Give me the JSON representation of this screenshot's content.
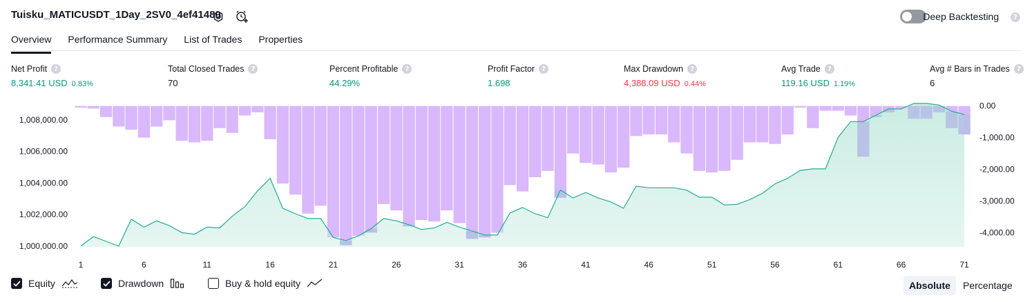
{
  "header": {
    "title": "Tuisku_MATICUSDT_1Day_2SV0_4ef41480",
    "deep_backtesting_label": "Deep Backtesting",
    "help_glyph": "?"
  },
  "tabs": [
    {
      "label": "Overview",
      "active": true
    },
    {
      "label": "Performance Summary",
      "active": false
    },
    {
      "label": "List of Trades",
      "active": false
    },
    {
      "label": "Properties",
      "active": false
    }
  ],
  "metrics": [
    {
      "label": "Net Profit",
      "value": "8,341.41 USD",
      "pct": "0.83%",
      "color": "green"
    },
    {
      "label": "Total Closed Trades",
      "value": "70",
      "pct": "",
      "color": "dark"
    },
    {
      "label": "Percent Profitable",
      "value": "44.29%",
      "pct": "",
      "color": "green"
    },
    {
      "label": "Profit Factor",
      "value": "1.698",
      "pct": "",
      "color": "green"
    },
    {
      "label": "Max Drawdown",
      "value": "4,388.09 USD",
      "pct": "0.44%",
      "color": "red"
    },
    {
      "label": "Avg Trade",
      "value": "119.16 USD",
      "pct": "1.19%",
      "color": "green"
    },
    {
      "label": "Avg # Bars in Trades",
      "value": "6",
      "pct": "",
      "color": "dark"
    }
  ],
  "legend": {
    "equity": {
      "label": "Equity",
      "checked": true
    },
    "drawdown": {
      "label": "Drawdown",
      "checked": true
    },
    "buy_hold": {
      "label": "Buy & hold equity",
      "checked": false
    }
  },
  "view_mode": {
    "absolute": "Absolute",
    "percentage": "Percentage",
    "selected": "Absolute"
  },
  "colors": {
    "equity_line": "#22ab94",
    "equity_fill": "#c8ebe1",
    "drawdown_bar": "#d9b8fb",
    "overlap_bar": "#b5bde6",
    "positive": "#089981",
    "negative": "#f23645"
  },
  "chart_data": {
    "type": "area",
    "x_ticks": [
      "1",
      "6",
      "11",
      "16",
      "21",
      "26",
      "31",
      "36",
      "41",
      "46",
      "51",
      "56",
      "61",
      "66",
      "71"
    ],
    "left_axis": {
      "ticks": [
        "1,000,000.00",
        "1,002,000.00",
        "1,004,000.00",
        "1,006,000.00",
        "1,008,000.00"
      ],
      "range": [
        999950,
        1009050
      ]
    },
    "right_axis": {
      "ticks": [
        "0.00",
        "-1,000.00",
        "-2,000.00",
        "-3,000.00",
        "-4,000.00"
      ],
      "range": [
        -4450,
        80
      ]
    },
    "series": [
      {
        "name": "Equity",
        "type": "area",
        "values": [
          1000000,
          1000600,
          1000300,
          1000000,
          1001700,
          1001200,
          1001600,
          1001300,
          1000850,
          1000750,
          1001200,
          1001150,
          1001900,
          1002500,
          1003500,
          1004300,
          1002400,
          1002050,
          1001750,
          1001750,
          1000550,
          1000350,
          1000650,
          1001100,
          1001750,
          1001600,
          1001350,
          1001050,
          1001150,
          1001500,
          1001200,
          1000950,
          1000700,
          1000700,
          1002100,
          1002450,
          1002050,
          1001800,
          1003550,
          1003050,
          1003400,
          1003050,
          1002800,
          1002400,
          1003800,
          1003700,
          1003700,
          1003700,
          1003550,
          1003100,
          1003100,
          1002600,
          1002650,
          1002950,
          1003350,
          1003950,
          1004300,
          1004800,
          1004900,
          1004900,
          1006900,
          1007900,
          1007900,
          1008300,
          1008700,
          1008700,
          1009050,
          1009050,
          1008950,
          1008550,
          1008350
        ]
      },
      {
        "name": "Drawdown",
        "type": "bar",
        "values": [
          -50,
          -80,
          -350,
          -650,
          -750,
          -1000,
          -650,
          -450,
          -1100,
          -1150,
          -1100,
          -700,
          -850,
          -300,
          -200,
          -1050,
          -2450,
          -2800,
          -3400,
          -3150,
          -4150,
          -4400,
          -4100,
          -4000,
          -3100,
          -3300,
          -3800,
          -3600,
          -3650,
          -3300,
          -3700,
          -4200,
          -4150,
          -4000,
          -2500,
          -2700,
          -2250,
          -2050,
          -2900,
          -1500,
          -1800,
          -1850,
          -2100,
          -1950,
          -950,
          -900,
          -900,
          -1150,
          -1500,
          -2050,
          -2100,
          -2050,
          -1700,
          -1150,
          -1150,
          -1200,
          -900,
          -50,
          -700,
          -150,
          -150,
          -300,
          -1600,
          -350,
          -200,
          -100,
          -400,
          -400,
          -200,
          -700,
          -900
        ]
      }
    ]
  }
}
